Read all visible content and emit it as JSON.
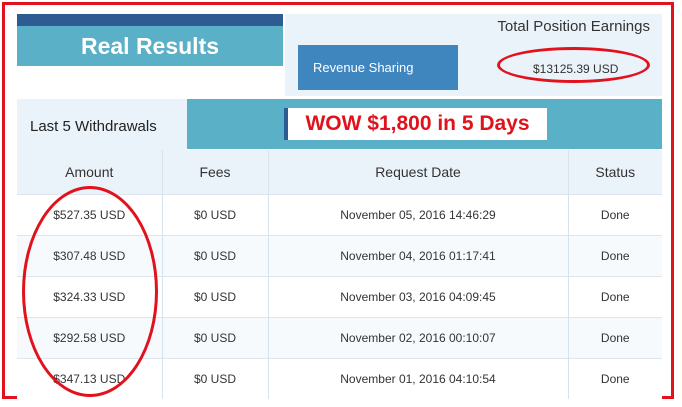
{
  "banner": {
    "title": "Real Results"
  },
  "earnings": {
    "title": "Total Position Earnings",
    "revenue_label": "Revenue Sharing",
    "revenue_value": "$13125.39 USD"
  },
  "withdrawals": {
    "label": "Last 5 Withdrawals",
    "headline": "WOW $1,800 in 5 Days",
    "columns": [
      "Amount",
      "Fees",
      "Request Date",
      "Status"
    ],
    "rows": [
      {
        "amount": "$527.35 USD",
        "fees": "$0 USD",
        "date": "November 05, 2016 14:46:29",
        "status": "Done"
      },
      {
        "amount": "$307.48 USD",
        "fees": "$0 USD",
        "date": "November 04, 2016 01:17:41",
        "status": "Done"
      },
      {
        "amount": "$324.33 USD",
        "fees": "$0 USD",
        "date": "November 03, 2016 04:09:45",
        "status": "Done"
      },
      {
        "amount": "$292.58 USD",
        "fees": "$0 USD",
        "date": "November 02, 2016 00:10:07",
        "status": "Done"
      },
      {
        "amount": "$347.13 USD",
        "fees": "$0 USD",
        "date": "November 01, 2016 04:10:54",
        "status": "Done"
      }
    ]
  },
  "colors": {
    "accent_red": "#e1121c",
    "teal": "#5ab0c7",
    "navy": "#2d5b92",
    "blue": "#3f85be",
    "panel_bg": "#eaf2fa"
  }
}
